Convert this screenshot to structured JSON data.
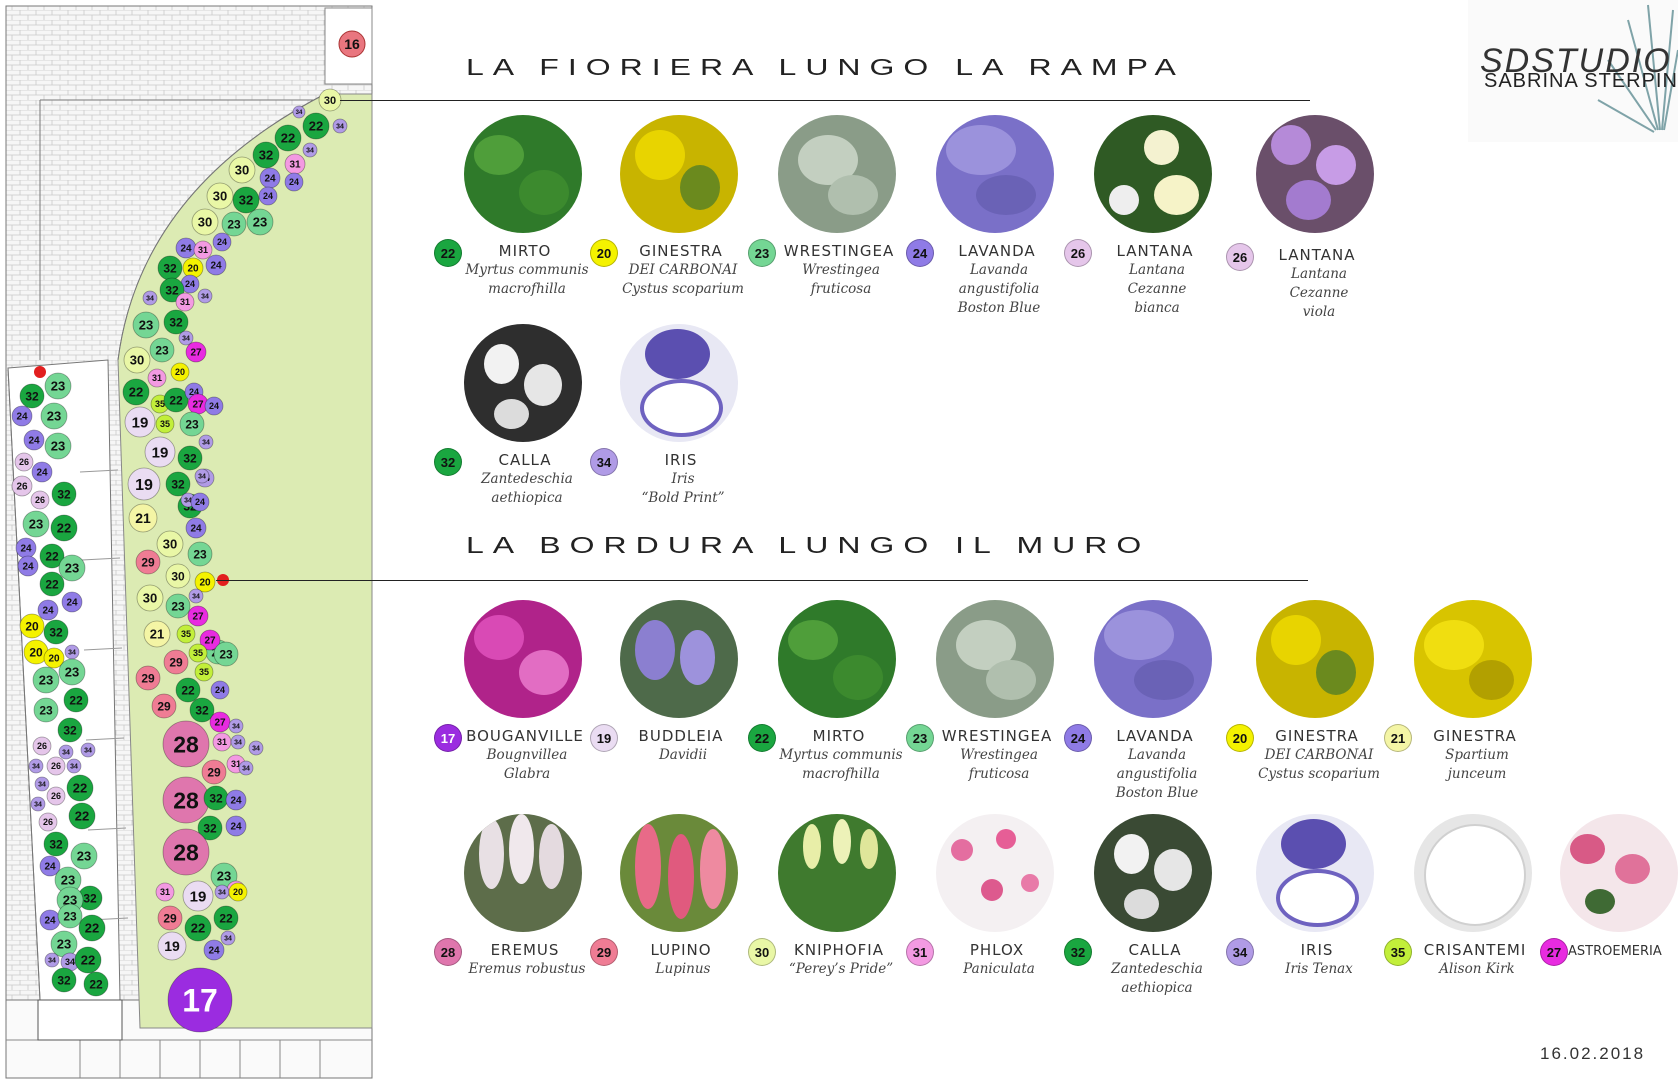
{
  "titles": {
    "ramp": "LA FIORIERA LUNGO LA RAMPA",
    "wall": "LA BORDURA LUNGO IL MURO"
  },
  "brand": {
    "line1": "SDSTUDIO",
    "line2": "SABRINA STERPIN"
  },
  "date": "16.02.2018",
  "colors": {
    "17": "#9b2ce0",
    "19": "#eadcf2",
    "20": "#f4f200",
    "21": "#f4f5a5",
    "22": "#1aa640",
    "23": "#74d694",
    "24": "#8f7be6",
    "26": "#e5c6ea",
    "27": "#e82be0",
    "28": "#df76ad",
    "29": "#ef7c94",
    "30": "#e9f7a6",
    "31": "#f39ae2",
    "32": "#1aa640",
    "34": "#b09be6",
    "35": "#c2ef3a",
    "lawn": "#dcebb3",
    "paving": "#f4f4f4",
    "red": "#e21f1f"
  },
  "plan": {
    "markers": [
      {
        "num": "16"
      }
    ]
  },
  "ramp_plants": [
    {
      "num": "22",
      "name": "MIRTO",
      "desc": [
        "Myrtus communis",
        "macrofhilla"
      ]
    },
    {
      "num": "20",
      "name": "GINESTRA",
      "desc": [
        "DEI CARBONAI",
        "Cystus scoparium"
      ]
    },
    {
      "num": "23",
      "name": "WRESTINGEA",
      "desc": [
        "Wrestingea",
        "fruticosa"
      ]
    },
    {
      "num": "24",
      "name": "LAVANDA",
      "desc": [
        "Lavanda",
        "angustifolia",
        "Boston Blue"
      ]
    },
    {
      "num": "26",
      "name": "LANTANA",
      "desc": [
        "Lantana",
        "Cezanne",
        "bianca"
      ]
    },
    {
      "num": "26",
      "name": "LANTANA",
      "desc": [
        "Lantana",
        "Cezanne",
        "viola"
      ]
    },
    {
      "num": "32",
      "name": "CALLA",
      "desc": [
        "Zantedeschia",
        "aethiopica"
      ]
    },
    {
      "num": "34",
      "name": "IRIS",
      "desc": [
        "Iris",
        "“Bold Print”"
      ]
    }
  ],
  "wall_plants": [
    {
      "num": "17",
      "name": "BOUGANVILLE",
      "desc": [
        "Bougnvillea",
        "Glabra"
      ]
    },
    {
      "num": "19",
      "name": "BUDDLEIA",
      "desc": [
        "Davidii"
      ]
    },
    {
      "num": "22",
      "name": "MIRTO",
      "desc": [
        "Myrtus communis",
        "macrofhilla"
      ]
    },
    {
      "num": "23",
      "name": "WRESTINGEA",
      "desc": [
        "Wrestingea",
        "fruticosa"
      ]
    },
    {
      "num": "24",
      "name": "LAVANDA",
      "desc": [
        "Lavanda",
        "angustifolia",
        "Boston Blue"
      ]
    },
    {
      "num": "20",
      "name": "GINESTRA",
      "desc": [
        "DEI CARBONAI",
        "Cystus scoparium"
      ]
    },
    {
      "num": "21",
      "name": "GINESTRA",
      "desc": [
        "Spartium",
        "junceum"
      ]
    },
    {
      "num": "28",
      "name": "EREMUS",
      "desc": [
        "Eremus robustus"
      ]
    },
    {
      "num": "29",
      "name": "LUPINO",
      "desc": [
        "Lupinus"
      ]
    },
    {
      "num": "30",
      "name": "KNIPHOFIA",
      "desc": [
        "“Perey’s Pride”"
      ]
    },
    {
      "num": "31",
      "name": "PHLOX",
      "desc": [
        "Paniculata"
      ]
    },
    {
      "num": "32",
      "name": "CALLA",
      "desc": [
        "Zantedeschia",
        "aethiopica"
      ]
    },
    {
      "num": "34",
      "name": "IRIS",
      "desc": [
        "Iris Tenax"
      ]
    },
    {
      "num": "35",
      "name": "CRISANTEMI",
      "desc": [
        "Alison Kirk"
      ]
    },
    {
      "num": "27",
      "name": "ASTROEMERIA",
      "desc": []
    }
  ]
}
